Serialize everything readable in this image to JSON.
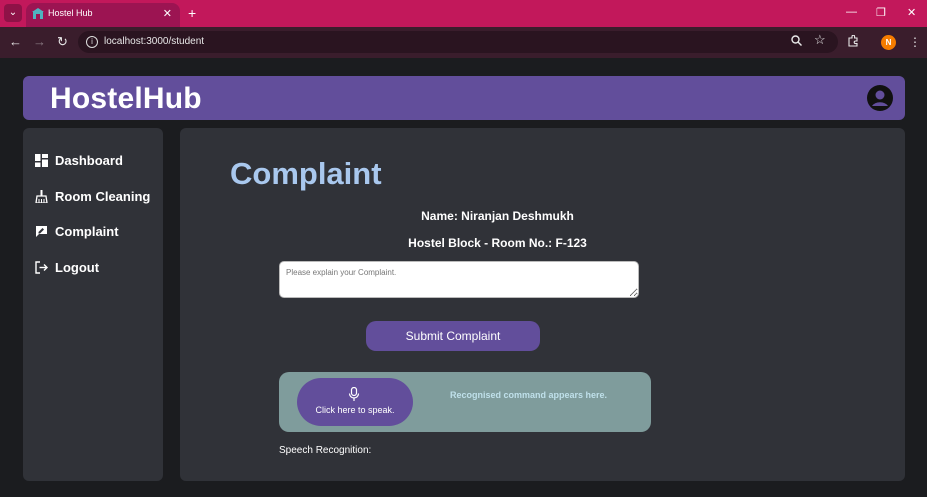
{
  "browser": {
    "tab_title": "Hostel Hub",
    "tab_close": "✕",
    "new_tab": "+",
    "url": "localhost:3000/student",
    "profile_initial": "N",
    "back": "←",
    "forward": "→",
    "reload": "↻",
    "minimize": "—",
    "restore": "❐",
    "close": "✕",
    "menu": "⋮",
    "zoom_icon": "🔍",
    "star_icon": "☆",
    "extensions_icon": "⧉"
  },
  "app": {
    "brand": "HostelHub",
    "accent": "#624e9b"
  },
  "sidebar": {
    "items": [
      {
        "label": "Dashboard",
        "icon": "dashboard-icon"
      },
      {
        "label": "Room Cleaning",
        "icon": "broom-icon"
      },
      {
        "label": "Complaint",
        "icon": "feedback-icon"
      },
      {
        "label": "Logout",
        "icon": "logout-icon"
      }
    ]
  },
  "main": {
    "title": "Complaint",
    "name_line": "Name: Niranjan Deshmukh",
    "block_line": "Hostel Block - Room No.: F-123",
    "complaint_placeholder": "Please explain your Complaint.",
    "complaint_value": "",
    "submit_label": "Submit Complaint",
    "speak_label": "Click here to speak.",
    "recognised_text": "Recognised command appears here.",
    "speech_recognition_label": "Speech Recognition:"
  }
}
